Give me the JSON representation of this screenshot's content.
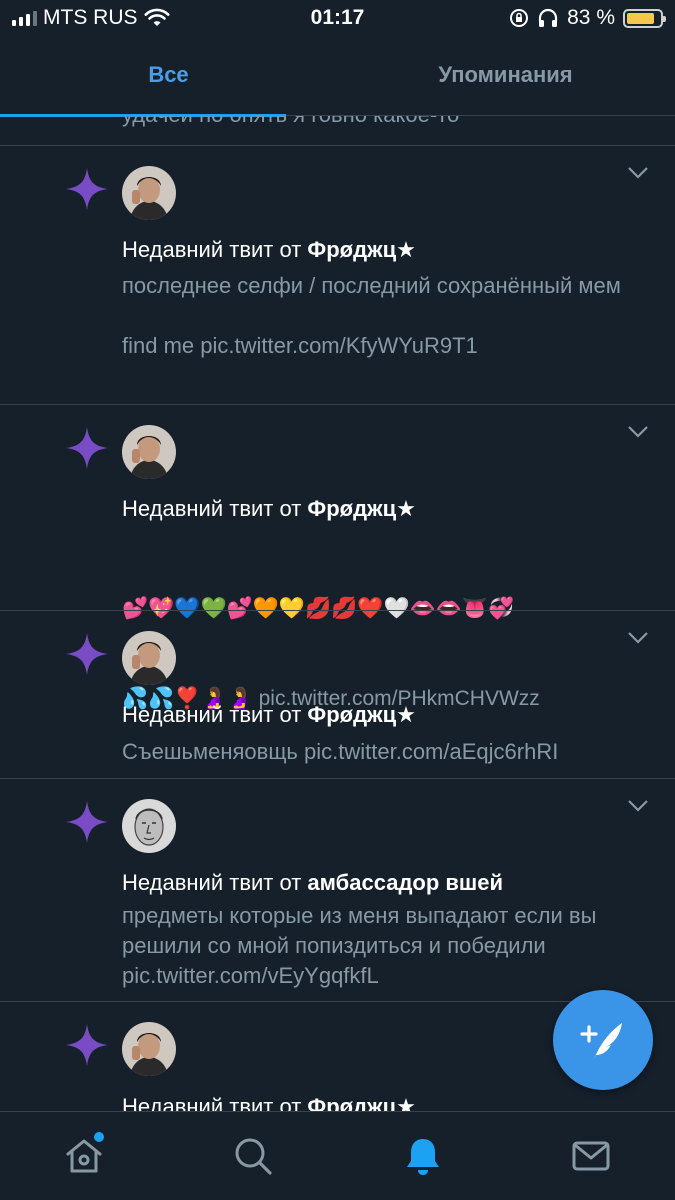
{
  "status_bar": {
    "carrier": "MTS RUS",
    "time": "01:17",
    "battery_percent": "83 %",
    "battery_level": 0.83
  },
  "tabs": {
    "all": "Все",
    "mentions": "Упоминания"
  },
  "feed": {
    "clipped_text": "удачей но опять я говно какое-то",
    "items": [
      {
        "prefix": "Недавний твит от ",
        "author": "Фрøджц★",
        "body": "последнее селфи / последний сохранённый мем\n\nfind me pic.twitter.com/KfyWYuR9T1"
      },
      {
        "prefix": "Недавний твит от ",
        "author": "Фрøджц★",
        "emojis": "💕💖💙💚💕🧡💛💋💋❤️🤍👄👄👅💞",
        "emojis_line2": "💦💦❣️🤰🤰",
        "link": "pic.twitter.com/PHkmCHVWzz"
      },
      {
        "prefix": "Недавний твит от ",
        "author": "Фрøджц★",
        "body": "Съешьменяовщь pic.twitter.com/aEqjc6rhRI"
      },
      {
        "prefix": "Недавний твит от ",
        "author": "амбассадор вшей",
        "body": "предметы которые из меня выпадают если вы решили со мной попиздиться и победили pic.twitter.com/vEyYgqfkfL"
      },
      {
        "prefix": "Недавний твит от ",
        "author": "Фрøджц★"
      }
    ]
  },
  "icons": {
    "notification": "sparkle-star-icon",
    "compose": "compose-tweet-icon",
    "home": "home-icon",
    "search": "search-icon",
    "notifications": "bell-icon",
    "messages": "envelope-icon"
  },
  "colors": {
    "background": "#15202b",
    "accent": "#1da1f2",
    "star": "#794bc4",
    "secondary_text": "#8899a6"
  }
}
